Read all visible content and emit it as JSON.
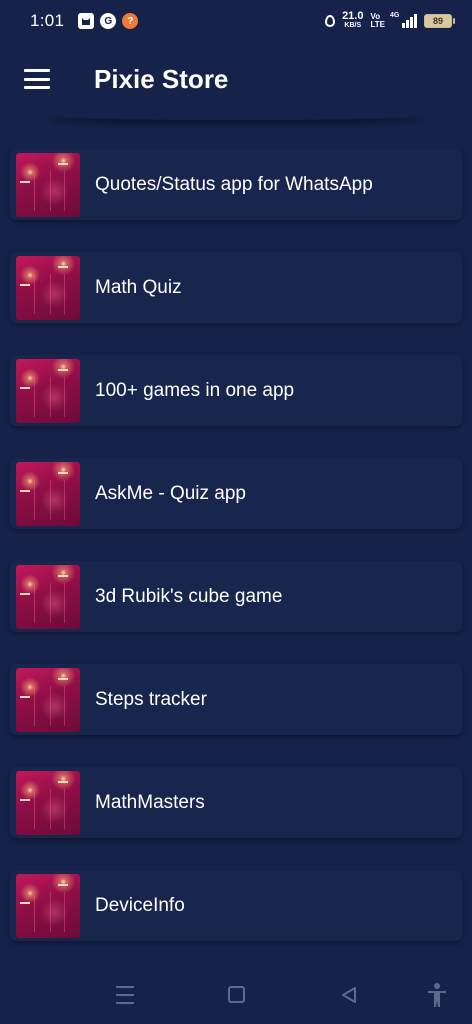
{
  "status_bar": {
    "time": "1:01",
    "left_icons": [
      "ws-cat-icon",
      "grammarly-icon",
      "help-orange-icon"
    ],
    "net_speed_value": "21.0",
    "net_speed_unit": "KB/S",
    "volte_top": "Vo",
    "volte_bottom": "LTE",
    "network_label": "4G",
    "battery_level": "89"
  },
  "app_bar": {
    "title": "Pixie Store",
    "menu_icon": "hamburger-icon"
  },
  "apps": [
    {
      "name": "Quotes/Status app for WhatsApp"
    },
    {
      "name": "Math Quiz"
    },
    {
      "name": "100+ games in one app"
    },
    {
      "name": "AskMe - Quiz app"
    },
    {
      "name": "3d Rubik's cube game"
    },
    {
      "name": "Steps tracker"
    },
    {
      "name": "MathMasters"
    },
    {
      "name": "DeviceInfo"
    }
  ],
  "nav_bar": {
    "icons": [
      "recent-apps-icon",
      "home-icon",
      "back-icon",
      "accessibility-icon"
    ]
  },
  "colors": {
    "background": "#162249",
    "card": "#18254d",
    "nav_icon": "#5d6a8e",
    "thumb_primary": "#c2185b"
  }
}
